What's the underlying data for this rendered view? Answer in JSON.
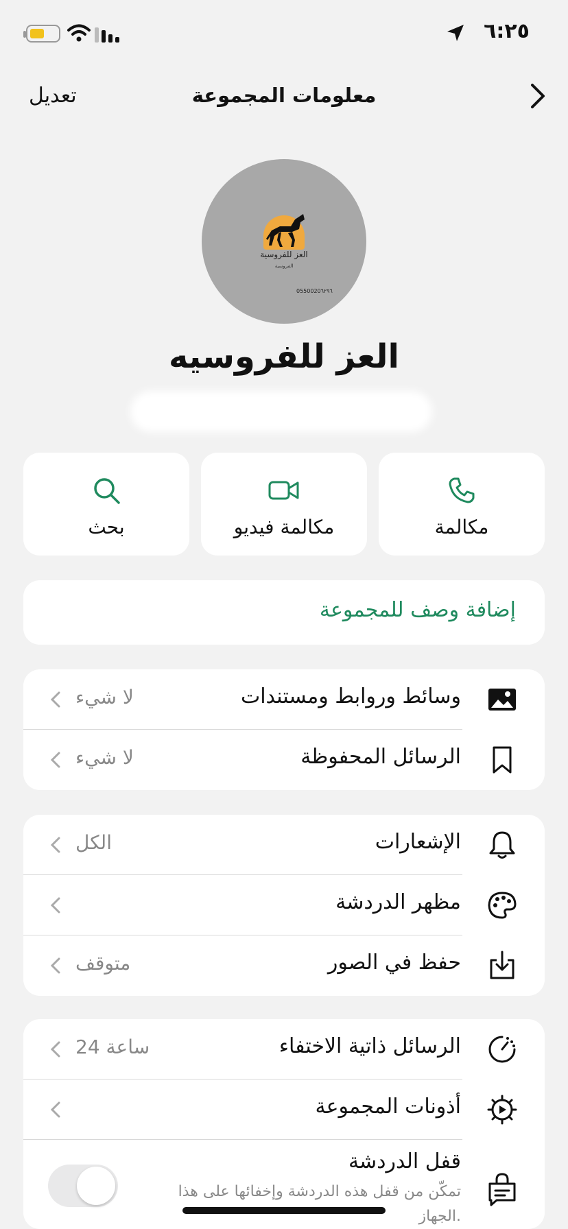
{
  "status_bar": {
    "time": "٦:٢٥",
    "icons": [
      "location-arrow-icon",
      "battery-icon",
      "wifi-icon",
      "cellular-signal-icon"
    ],
    "battery_color": "#f2c21b"
  },
  "nav": {
    "title": "معلومات المجموعة",
    "edit": "تعديل",
    "back_icon": "chevron-right-icon"
  },
  "avatar": {
    "logo_text": "العز للفروسية",
    "logo_sub": "الفروسية",
    "phone": "0550020٦٢٩٦"
  },
  "group": {
    "name": "العز للفروسيه"
  },
  "actions": [
    {
      "label": "مكالمة",
      "icon": "phone-icon"
    },
    {
      "label": "مكالمة فيديو",
      "icon": "video-icon"
    },
    {
      "label": "بحث",
      "icon": "search-icon"
    }
  ],
  "description": {
    "add_label": "إضافة وصف للمجموعة"
  },
  "section1": [
    {
      "label": "وسائط وروابط ومستندات",
      "value": "لا شيء",
      "icon": "photo-icon"
    },
    {
      "label": "الرسائل المحفوظة",
      "value": "لا شيء",
      "icon": "bookmark-icon"
    }
  ],
  "section2": [
    {
      "label": "الإشعارات",
      "value": "الكل",
      "icon": "bell-icon"
    },
    {
      "label": "مظهر الدردشة",
      "value": "",
      "icon": "palette-icon"
    },
    {
      "label": "حفظ في الصور",
      "value": "متوقف",
      "icon": "download-icon"
    }
  ],
  "section3": [
    {
      "label": "الرسائل ذاتية الاختفاء",
      "value": "24 ساعة",
      "icon": "timer-icon"
    },
    {
      "label": "أذونات المجموعة",
      "value": "",
      "icon": "gear-icon"
    }
  ],
  "chat_lock": {
    "label": "قفل الدردشة",
    "description": "تمكّن من قفل هذه الدردشة وإخفائها على هذا الجهاز.",
    "enabled": false,
    "icon": "lock-chat-icon"
  },
  "colors": {
    "accent": "#1f8a5e",
    "background": "#f2f2f2",
    "card": "#ffffff",
    "secondary_text": "#888888"
  }
}
